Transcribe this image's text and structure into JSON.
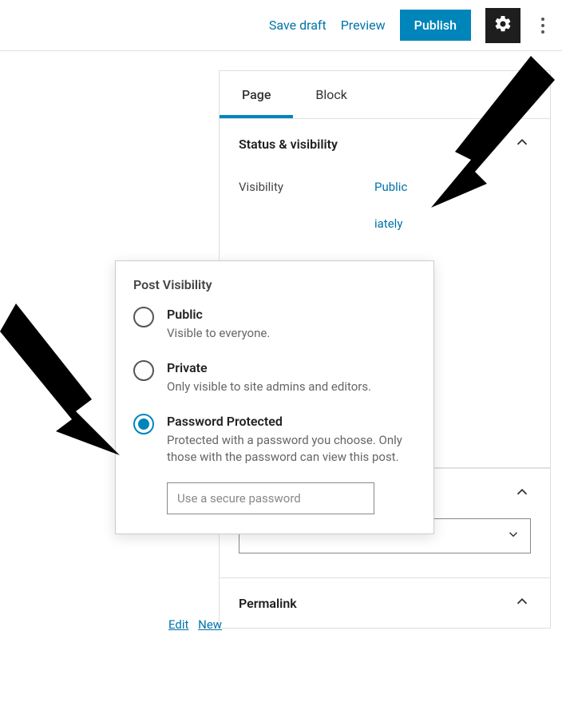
{
  "topbar": {
    "save_draft": "Save draft",
    "preview": "Preview",
    "publish": "Publish"
  },
  "tabs": {
    "page": "Page",
    "block": "Block"
  },
  "status_visibility": {
    "title": "Status & visibility",
    "visibility_label": "Visibility",
    "visibility_value": "Public",
    "publish_value_partial": "iately"
  },
  "popover": {
    "title": "Post Visibility",
    "options": [
      {
        "label": "Public",
        "desc": "Visible to everyone."
      },
      {
        "label": "Private",
        "desc": "Only visible to site admins and editors."
      },
      {
        "label": "Password Protected",
        "desc": "Protected with a password you choose. Only those with the password can view this post."
      }
    ],
    "password_placeholder": "Use a secure password"
  },
  "edit_new": {
    "edit": "Edit",
    "new": "New"
  },
  "permalink": {
    "title": "Permalink"
  }
}
